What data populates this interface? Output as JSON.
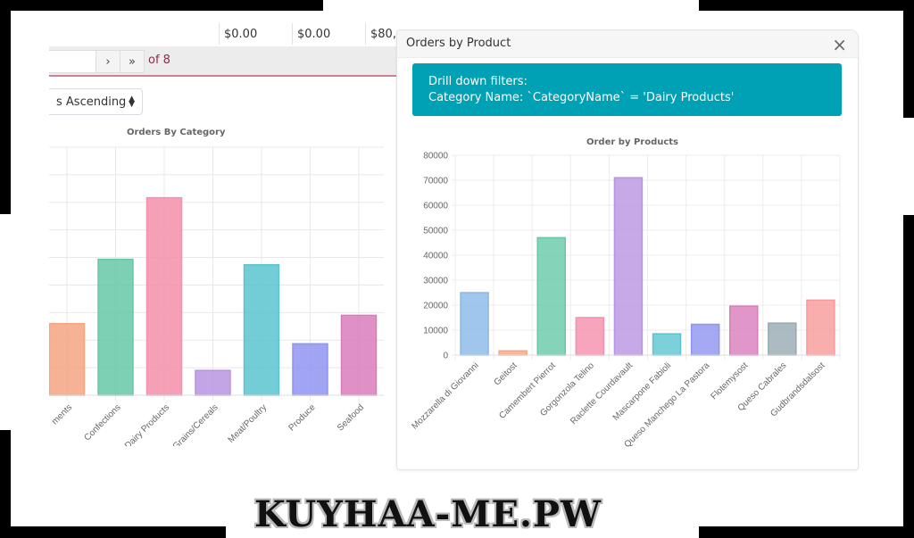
{
  "table_fragment": {
    "cells": [
      "$0.00",
      "$0.00",
      "$80,"
    ]
  },
  "pager": {
    "next_label": "›",
    "last_label": "»",
    "of_text": "of 8"
  },
  "sort_select": {
    "selected": "s Ascending"
  },
  "modal": {
    "title": "Orders by Product",
    "close_label": "×",
    "alert": {
      "line1": "Drill down filters:",
      "line2": "Category Name: `CategoryName` = 'Dairy Products'"
    }
  },
  "watermark": "KUYHAA-ME.PW",
  "colors": {
    "alert_bg": "#00a0b5",
    "pager_text": "#8a2c4a"
  },
  "chart_data": [
    {
      "type": "bar",
      "title": "Orders By Category",
      "xlabel": "",
      "ylabel": "",
      "y_axis_labels_visible": false,
      "ylim": [
        0,
        270000
      ],
      "grid": true,
      "categories": [
        "Condiments",
        "Confections",
        "Dairy Products",
        "Grains/Cereals",
        "Meat/Poultry",
        "Produce",
        "Seafood"
      ],
      "visible_category_labels": [
        "ments",
        "Confections",
        "Dairy Products",
        "Grains/Cereals",
        "Meat/Poultry",
        "Produce",
        "Seafood"
      ],
      "values": [
        78000,
        148000,
        215000,
        27000,
        142000,
        56000,
        87000
      ],
      "colors": [
        "#f4a582",
        "#66c8a6",
        "#f48fac",
        "#b894e0",
        "#5bc4d0",
        "#8f94f0",
        "#d97cbb"
      ]
    },
    {
      "type": "bar",
      "title": "Order by Products",
      "xlabel": "",
      "ylabel": "",
      "ylim": [
        0,
        80000
      ],
      "yticks": [
        0,
        10000,
        20000,
        30000,
        40000,
        50000,
        60000,
        70000,
        80000
      ],
      "grid": true,
      "categories": [
        "Mozzarella di Giovanni",
        "Geitost",
        "Camembert Pierrot",
        "Gorgonzola Telino",
        "Raclette Courdavault",
        "Mascarpone Fabioli",
        "Queso Manchego La Pastora",
        "Flotemysost",
        "Queso Cabrales",
        "Gudbrandsdalsost"
      ],
      "values": [
        25000,
        1700,
        47000,
        15000,
        71000,
        8500,
        12300,
        19600,
        12800,
        22000
      ],
      "colors": [
        "#8ab8e6",
        "#f4a582",
        "#66c8a6",
        "#f48fac",
        "#b894e0",
        "#5bc4d0",
        "#8f94f0",
        "#d97cbb",
        "#97aab3",
        "#f79a9a"
      ]
    }
  ]
}
